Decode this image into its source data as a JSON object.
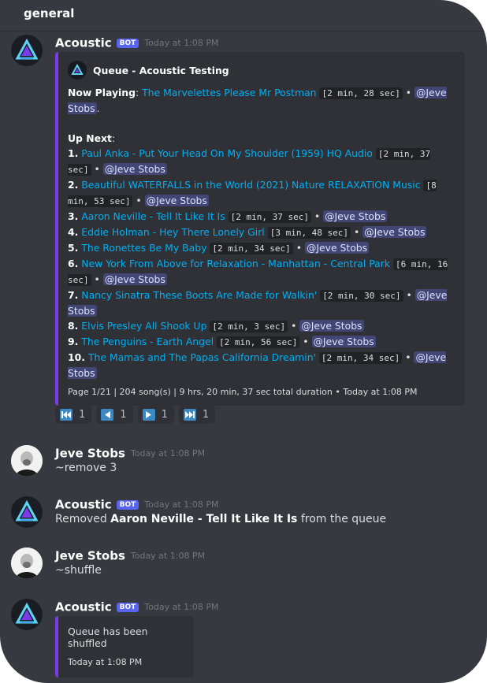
{
  "channel": {
    "name": "general"
  },
  "messages": [
    {
      "author": "Acoustic",
      "badge": "BOT",
      "time": "Today at 1:08 PM",
      "embed": {
        "author": "Queue - Acoustic Testing",
        "now_playing_label": "Now Playing",
        "now_playing_song": "The Marvelettes Please Mr Postman",
        "now_playing_duration": "[2 min, 28 sec]",
        "now_playing_by": "@Jeve Stobs",
        "up_next_label": "Up Next",
        "items": [
          {
            "num": "1.",
            "song": "Paul Anka - Put Your Head On My Shoulder (1959) HQ Audio",
            "duration": "[2 min, 37 sec]",
            "by": "@Jeve Stobs"
          },
          {
            "num": "2.",
            "song": "Beautiful WATERFALLS in the World (2021) Nature RELAXATION Music",
            "duration": "[8 min, 53 sec]",
            "by": "@Jeve Stobs"
          },
          {
            "num": "3.",
            "song": "Aaron Neville - Tell It Like It Is",
            "duration": "[2 min, 37 sec]",
            "by": "@Jeve Stobs"
          },
          {
            "num": "4.",
            "song": "Eddie Holman - Hey There Lonely Girl",
            "duration": "[3 min, 48 sec]",
            "by": "@Jeve Stobs"
          },
          {
            "num": "5.",
            "song": "The Ronettes Be My Baby",
            "duration": "[2 min, 34 sec]",
            "by": "@Jeve Stobs"
          },
          {
            "num": "6.",
            "song": "New York From Above for Relaxation - Manhattan - Central Park",
            "duration": "[6 min, 16 sec]",
            "by": "@Jeve Stobs"
          },
          {
            "num": "7.",
            "song": "Nancy Sinatra These Boots Are Made for Walkin'",
            "duration": "[2 min, 30 sec]",
            "by": "@Jeve Stobs"
          },
          {
            "num": "8.",
            "song": "Elvis Presley All Shook Up",
            "duration": "[2 min, 3 sec]",
            "by": "@Jeve Stobs"
          },
          {
            "num": "9.",
            "song": "The Penguins - Earth Angel",
            "duration": "[2 min, 56 sec]",
            "by": "@Jeve Stobs"
          },
          {
            "num": "10.",
            "song": "The Mamas and The Papas California Dreamin'",
            "duration": "[2 min, 34 sec]",
            "by": "@Jeve Stobs"
          }
        ],
        "footer_text": "Page 1/21 | 204 song(s) | 9 hrs, 20 min, 37 sec total duration",
        "footer_time": "Today at 1:08 PM"
      },
      "reactions": [
        {
          "icon": "first-page-icon",
          "count": "1"
        },
        {
          "icon": "previous-page-icon",
          "count": "1"
        },
        {
          "icon": "next-page-icon",
          "count": "1"
        },
        {
          "icon": "last-page-icon",
          "count": "1"
        }
      ]
    },
    {
      "author": "Jeve Stobs",
      "time": "Today at 1:08 PM",
      "text": "~remove 3"
    },
    {
      "author": "Acoustic",
      "badge": "BOT",
      "time": "Today at 1:08 PM",
      "text_prefix": "Removed",
      "text_bold": "Aaron Neville - Tell It Like It Is",
      "text_suffix": "from the queue"
    },
    {
      "author": "Jeve Stobs",
      "time": "Today at 1:08 PM",
      "text": "~shuffle"
    },
    {
      "author": "Acoustic",
      "badge": "BOT",
      "time": "Today at 1:08 PM",
      "embed": {
        "description": "Queue has been shuffled",
        "footer_time": "Today at 1:08 PM"
      }
    }
  ],
  "colors": {
    "accent": "#7c3aed",
    "link": "#00aff4",
    "mention_bg": "#414675",
    "bot_badge": "#5865f2"
  }
}
